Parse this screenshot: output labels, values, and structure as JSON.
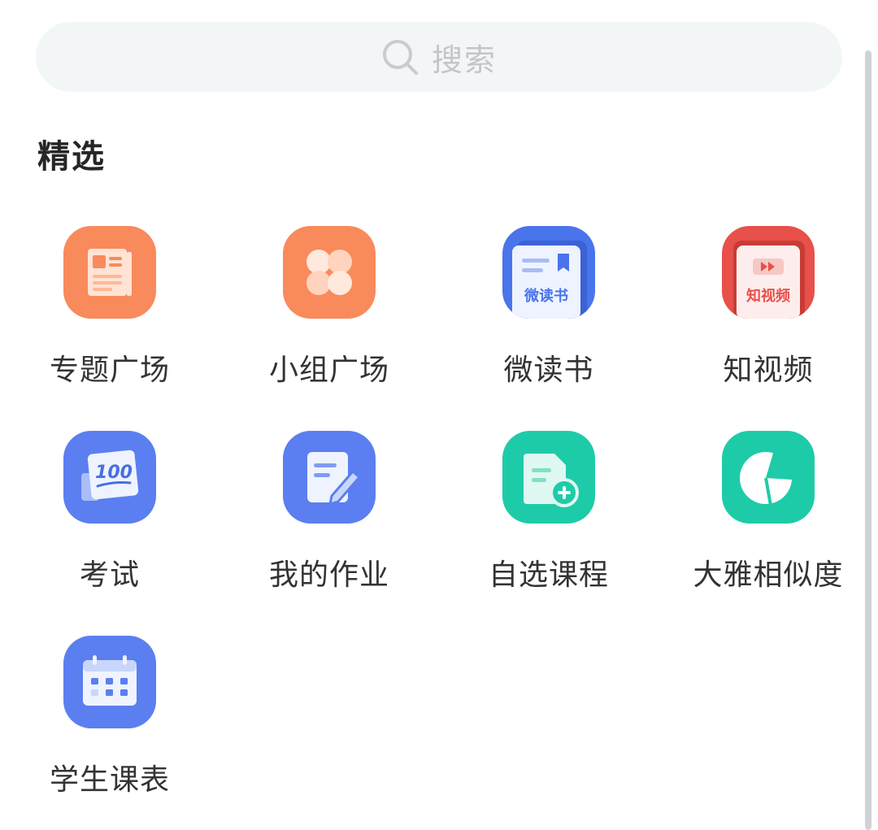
{
  "search": {
    "placeholder": "搜索",
    "icon": "search-icon"
  },
  "section": {
    "title": "精选"
  },
  "items": [
    {
      "label": "专题广场",
      "icon": "newspaper-icon",
      "color": "#f98a5c"
    },
    {
      "label": "小组广场",
      "icon": "group-circles-icon",
      "color": "#f98a5c"
    },
    {
      "label": "微读书",
      "icon": "book-icon",
      "color": "#4a74ec",
      "badge": "微读书"
    },
    {
      "label": "知视频",
      "icon": "video-play-icon",
      "color": "#e8504a",
      "badge": "知视频"
    },
    {
      "label": "考试",
      "icon": "exam-paper-icon",
      "color": "#5b7ff0",
      "badge": "100"
    },
    {
      "label": "我的作业",
      "icon": "homework-edit-icon",
      "color": "#5b7ff0"
    },
    {
      "label": "自选课程",
      "icon": "add-course-icon",
      "color": "#1ecba8"
    },
    {
      "label": "大雅相似度",
      "icon": "pie-chart-icon",
      "color": "#1ecba8"
    },
    {
      "label": "学生课表",
      "icon": "calendar-icon",
      "color": "#5b7ff0"
    }
  ]
}
